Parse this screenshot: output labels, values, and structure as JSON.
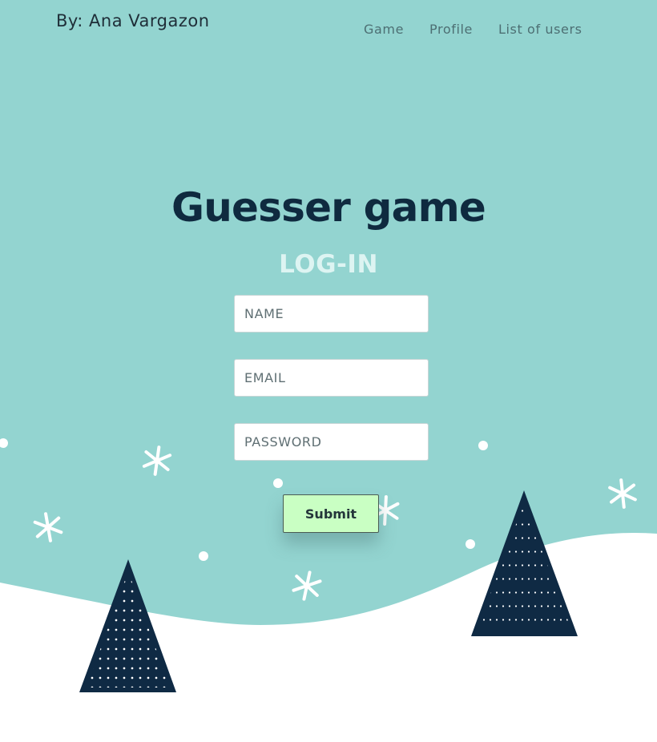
{
  "header": {
    "brand": "By: Ana Vargazon",
    "nav": [
      "Game",
      "Profile",
      "List of users"
    ]
  },
  "main": {
    "title": "Guesser game",
    "subtitle": "LOG-IN",
    "form": {
      "name_placeholder": "NAME",
      "email_placeholder": "EMAIL",
      "password_placeholder": "PASSWORD",
      "submit_label": "Submit"
    }
  },
  "colors": {
    "sky": "#93d4d0",
    "snow_ground": "#ffffff",
    "tree": "#0f2a44",
    "title": "#0f2a3f",
    "subtitle": "#ddf4f2",
    "submit_bg": "#c9ffc3"
  },
  "icons": {
    "trees": "christmas-tree-icon",
    "snow": "snowflake-icon"
  }
}
